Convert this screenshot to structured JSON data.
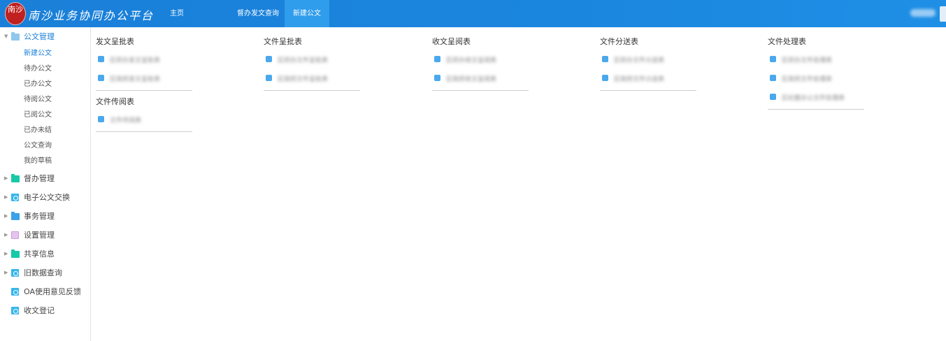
{
  "header": {
    "logo_seal_text": "南沙",
    "app_title": "南沙业务协同办公平台",
    "nav": [
      {
        "label": "主页"
      },
      {
        "label": "督办发文查询"
      },
      {
        "label": "新建公文"
      }
    ],
    "brand_color": "#1a7fd8"
  },
  "sidebar": {
    "groups": [
      {
        "label": "公文管理",
        "icon": "folder-open-icon",
        "expanded": true,
        "items": [
          "新建公文",
          "待办公文",
          "已办公文",
          "待阅公文",
          "已阅公文",
          "已办未结",
          "公文查询",
          "我的草稿"
        ]
      },
      {
        "label": "督办管理",
        "icon": "folder-teal-icon"
      },
      {
        "label": "电子公文交换",
        "icon": "gear-square-icon"
      },
      {
        "label": "事务管理",
        "icon": "folder-blue-icon"
      },
      {
        "label": "设置管理",
        "icon": "settings-square-icon"
      },
      {
        "label": "共享信息",
        "icon": "folder-teal-icon"
      },
      {
        "label": "旧数据查询",
        "icon": "gear-square-icon"
      },
      {
        "label": "OA使用意见反馈",
        "icon": "gear-square-icon"
      },
      {
        "label": "收文登记",
        "icon": "gear-square-icon"
      }
    ]
  },
  "cards": [
    {
      "title": "发文呈批表",
      "items": [
        "区府办发文呈批表",
        "区政府发文呈批表"
      ]
    },
    {
      "title": "文件呈批表",
      "items": [
        "区府办文件呈批表",
        "区政府文件呈批表"
      ]
    },
    {
      "title": "收文呈阅表",
      "items": [
        "区府办收文呈阅表",
        "区政府收文呈阅表"
      ]
    },
    {
      "title": "文件分送表",
      "items": [
        "区府办文件分送表",
        "区政府文件分送表"
      ]
    },
    {
      "title": "文件处理表",
      "items": [
        "区府办文件处理表",
        "区政府文件处理表",
        "区纪委办公文件处理表"
      ]
    },
    {
      "title": "文件传阅表",
      "items": [
        "文件传阅表"
      ]
    }
  ]
}
